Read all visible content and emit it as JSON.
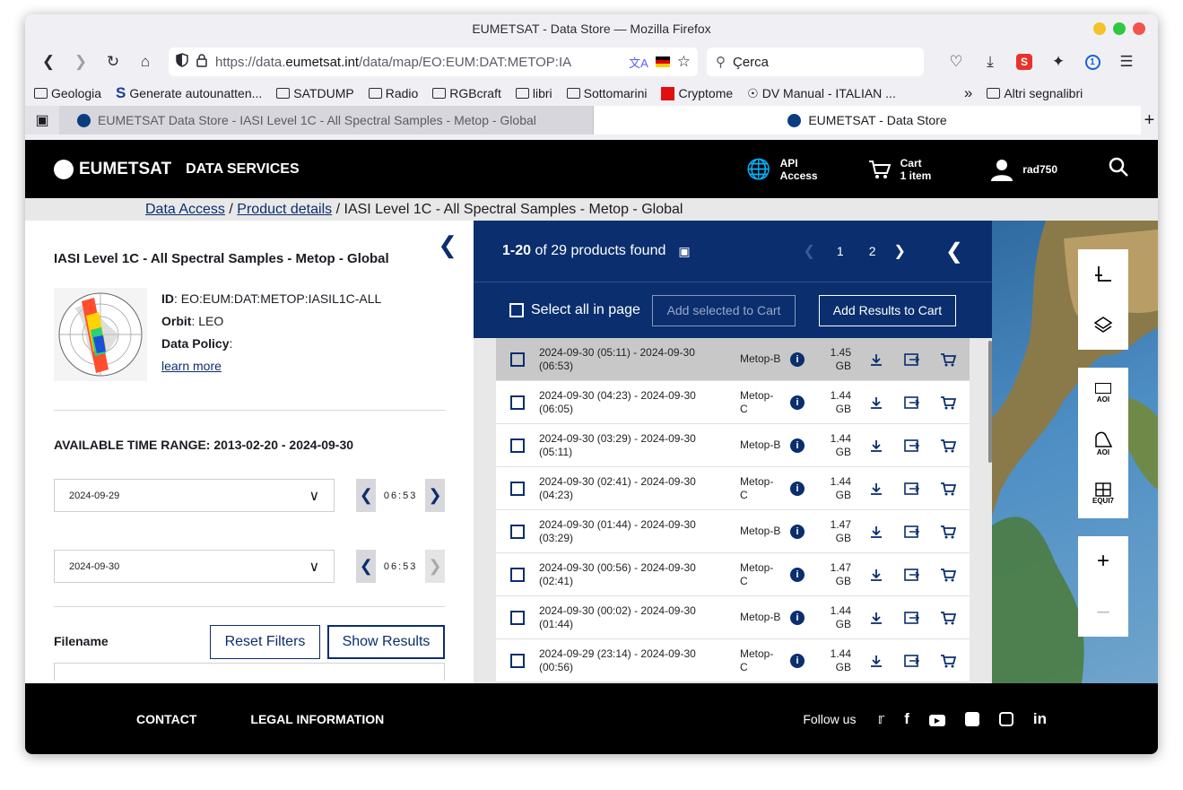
{
  "browser": {
    "window_title": "EUMETSAT - Data Store — Mozilla Firefox",
    "url_prefix": "https://data.",
    "url_domain": "eumetsat.int",
    "url_path": "/data/map/EO:EUM:DAT:METOP:IA",
    "search_placeholder": "Çerca",
    "bookmarks": [
      "Geologia",
      "Generate autounatten...",
      "SATDUMP",
      "Radio",
      "RGBcraft",
      "libri",
      "Sottomarini",
      "Cryptome",
      "DV Manual - ITALIAN ...",
      "Altri segnalibri"
    ],
    "tabs": [
      {
        "label": "EUMETSAT Data Store - IASI Level 1C - All Spectral Samples - Metop - Global",
        "active": false
      },
      {
        "label": "EUMETSAT - Data Store",
        "active": true
      }
    ]
  },
  "header": {
    "logo": "EUMETSAT",
    "services": "DATA SERVICES",
    "api_line1": "API",
    "api_line2": "Access",
    "cart_line1": "Cart",
    "cart_line2": "1 item",
    "user": "rad750"
  },
  "breadcrumb": {
    "item1": "Data Access",
    "sep": "/",
    "item2": "Product details",
    "current": "IASI Level 1C - All Spectral Samples - Metop - Global"
  },
  "product": {
    "title": "IASI Level 1C - All Spectral Samples - Metop - Global",
    "id_label": "ID",
    "id_value": ": EO:EUM:DAT:METOP:IASIL1C-ALL",
    "orbit_label": "Orbit",
    "orbit_value": ": LEO",
    "policy_label": "Data Policy",
    "policy_value": ":",
    "learn_more": "learn more",
    "range_label": "AVAILABLE TIME RANGE: 2013-02-20 - 2024-09-30",
    "start_date": "2024-09-29",
    "start_time": "06:53",
    "end_date": "2024-09-30",
    "end_time": "06:53",
    "filename_label": "Filename",
    "reset_label": "Reset Filters",
    "show_label": "Show Results"
  },
  "results": {
    "count_bold": "1-20",
    "count_rest": "of 29 products found",
    "page1": "1",
    "page2": "2",
    "select_all": "Select all in page",
    "add_selected": "Add selected to Cart",
    "add_results": "Add Results to Cart",
    "rows": [
      {
        "date1": "2024-09-30 (05:11) - 2024-09-30",
        "date2": "(06:53)",
        "sat1": "Metop-B",
        "sat2": "",
        "size1": "1.45",
        "size2": "GB"
      },
      {
        "date1": "2024-09-30 (04:23) - 2024-09-30",
        "date2": "(06:05)",
        "sat1": "Metop-",
        "sat2": "C",
        "size1": "1.44",
        "size2": "GB"
      },
      {
        "date1": "2024-09-30 (03:29) - 2024-09-30",
        "date2": "(05:11)",
        "sat1": "Metop-B",
        "sat2": "",
        "size1": "1.44",
        "size2": "GB"
      },
      {
        "date1": "2024-09-30 (02:41) - 2024-09-30",
        "date2": "(04:23)",
        "sat1": "Metop-",
        "sat2": "C",
        "size1": "1.44",
        "size2": "GB"
      },
      {
        "date1": "2024-09-30 (01:44) - 2024-09-30",
        "date2": "(03:29)",
        "sat1": "Metop-B",
        "sat2": "",
        "size1": "1.47",
        "size2": "GB"
      },
      {
        "date1": "2024-09-30 (00:56) - 2024-09-30",
        "date2": "(02:41)",
        "sat1": "Metop-",
        "sat2": "C",
        "size1": "1.47",
        "size2": "GB"
      },
      {
        "date1": "2024-09-30 (00:02) - 2024-09-30",
        "date2": "(01:44)",
        "sat1": "Metop-B",
        "sat2": "",
        "size1": "1.44",
        "size2": "GB"
      },
      {
        "date1": "2024-09-29 (23:14) - 2024-09-30",
        "date2": "(00:56)",
        "sat1": "Metop-",
        "sat2": "C",
        "size1": "1.44",
        "size2": "GB"
      }
    ]
  },
  "map": {
    "aoi1": "AOI",
    "aoi2": "AOI",
    "equi": "EQUI7"
  },
  "footer": {
    "contact": "CONTACT",
    "legal": "LEGAL INFORMATION",
    "follow": "Follow us"
  }
}
